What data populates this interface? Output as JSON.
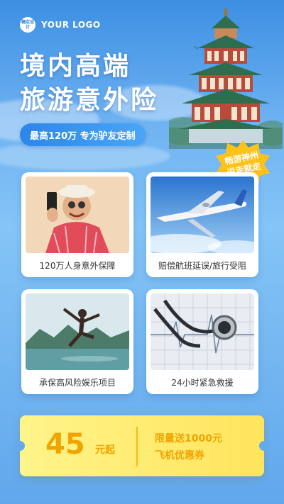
{
  "logo": {
    "badge": "稿定设计",
    "text": "YOUR LOGO"
  },
  "headline": {
    "line1": "境内高端",
    "line2": "旅游意外险"
  },
  "tagline": "最高120万 专为驴友定制",
  "burst": {
    "line1": "畅游神州",
    "line2": "说走就走"
  },
  "cards": [
    {
      "caption": "120万人身意外保障",
      "image": "man-with-phone-photo"
    },
    {
      "caption": "赔偿航班延误/旅行受阻",
      "image": "airplane-photo"
    },
    {
      "caption": "承保高风险娱乐项目",
      "image": "jumping-man-lake-photo"
    },
    {
      "caption": "24小时紧急救援",
      "image": "stethoscope-photo"
    }
  ],
  "coupon": {
    "price": "45",
    "unit": "元起",
    "line1": "限量送1000元",
    "line2": "飞机优惠券"
  },
  "colors": {
    "accent": "#f0a400",
    "brand": "#2c86ea",
    "burst": "#ffc21a"
  }
}
